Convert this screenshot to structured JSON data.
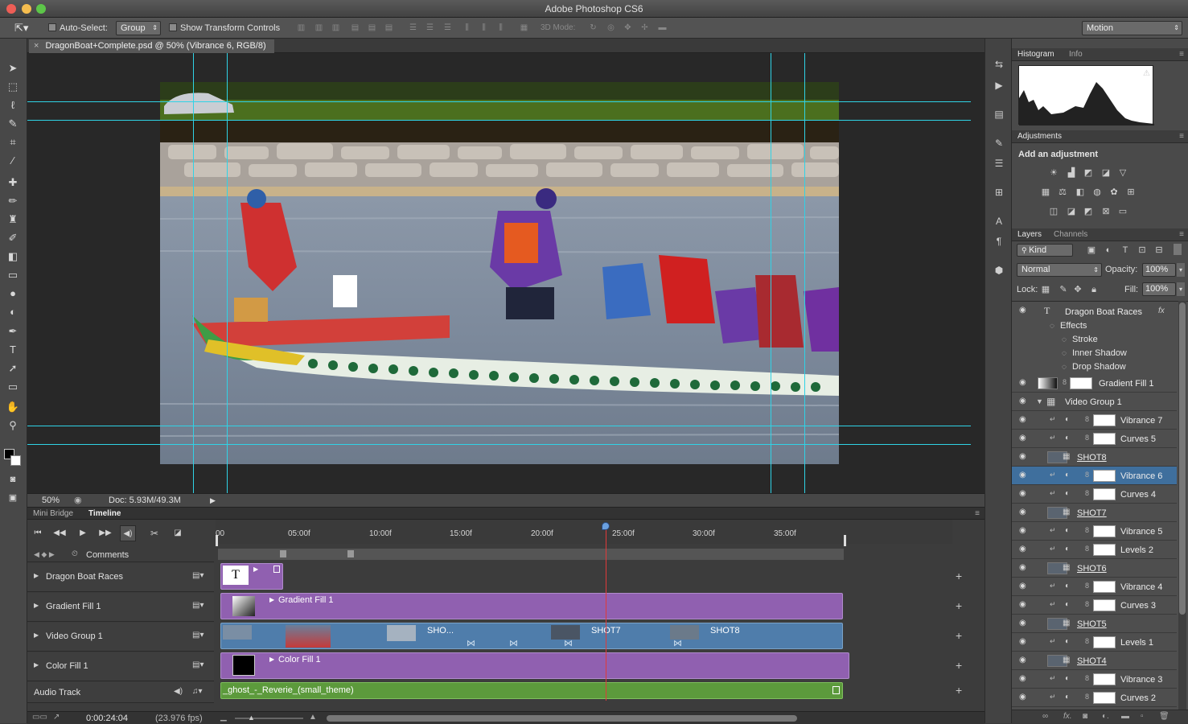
{
  "app": {
    "title": "Adobe Photoshop CS6",
    "workspace": "Motion"
  },
  "options": {
    "auto_select_label": "Auto-Select:",
    "auto_select_value": "Group",
    "show_transform_label": "Show Transform Controls",
    "mode_3d_label": "3D Mode:"
  },
  "document": {
    "tab_title": "DragonBoat+Complete.psd @ 50% (Vibrance 6, RGB/8)"
  },
  "status": {
    "zoom": "50%",
    "doc_size": "Doc: 5.93M/49.3M"
  },
  "timeline": {
    "tabs": [
      "Mini Bridge",
      "Timeline"
    ],
    "ruler": [
      "00",
      "05:00f",
      "10:00f",
      "15:00f",
      "20:00f",
      "25:00f",
      "30:00f",
      "35:00f"
    ],
    "comments_label": "Comments",
    "tracks": [
      {
        "name": "Dragon Boat Races"
      },
      {
        "name": "Gradient Fill 1"
      },
      {
        "name": "Video Group 1"
      },
      {
        "name": "Color Fill 1"
      }
    ],
    "audio_track_label": "Audio Track",
    "clips": {
      "text_clip": "T",
      "gradient_clip": "Gradient Fill 1",
      "shot_clip_a": "SHO...",
      "shot_clip_b": "SHOT7",
      "shot_clip_c": "SHOT8",
      "color_clip": "Color Fill 1",
      "audio_clip": "_ghost_-_Reverie_(small_theme)"
    },
    "timecode": "0:00:24:04",
    "fps": "(23.976 fps)",
    "playhead_fraction": 0.62
  },
  "histogram": {
    "tabs": [
      "Histogram",
      "Info"
    ]
  },
  "adjustments": {
    "title": "Adjustments",
    "add_label": "Add an adjustment"
  },
  "layers": {
    "tabs": [
      "Layers",
      "Channels"
    ],
    "filter_kind": "Kind",
    "blend_mode": "Normal",
    "opacity_label": "Opacity:",
    "opacity": "100%",
    "lock_label": "Lock:",
    "fill_label": "Fill:",
    "fill": "100%",
    "text_layer": "Dragon Boat Races",
    "effects_label": "Effects",
    "effects": [
      "Stroke",
      "Inner Shadow",
      "Drop Shadow"
    ],
    "gradient_layer": "Gradient Fill 1",
    "group_layer": "Video Group 1",
    "items": [
      {
        "name": "Vibrance 7",
        "type": "adj"
      },
      {
        "name": "Curves 5",
        "type": "adj"
      },
      {
        "name": "SHOT8",
        "type": "video"
      },
      {
        "name": "Vibrance 6",
        "type": "adj",
        "selected": true
      },
      {
        "name": "Curves 4",
        "type": "adj"
      },
      {
        "name": "SHOT7",
        "type": "video"
      },
      {
        "name": "Vibrance 5",
        "type": "adj"
      },
      {
        "name": "Levels 2",
        "type": "adj"
      },
      {
        "name": "SHOT6",
        "type": "video"
      },
      {
        "name": "Vibrance 4",
        "type": "adj"
      },
      {
        "name": "Curves 3",
        "type": "adj"
      },
      {
        "name": "SHOT5",
        "type": "video"
      },
      {
        "name": "Levels 1",
        "type": "adj"
      },
      {
        "name": "SHOT4",
        "type": "video"
      },
      {
        "name": "Vibrance 3",
        "type": "adj"
      },
      {
        "name": "Curves 2",
        "type": "adj"
      }
    ]
  },
  "colors": {
    "accent": "#2fd3e6",
    "timeline_purple": "#9060b0",
    "timeline_blue": "#4f7dab",
    "timeline_green": "#5c9a3c",
    "playhead": "#e03a3a",
    "selection": "#3f6f9d"
  }
}
